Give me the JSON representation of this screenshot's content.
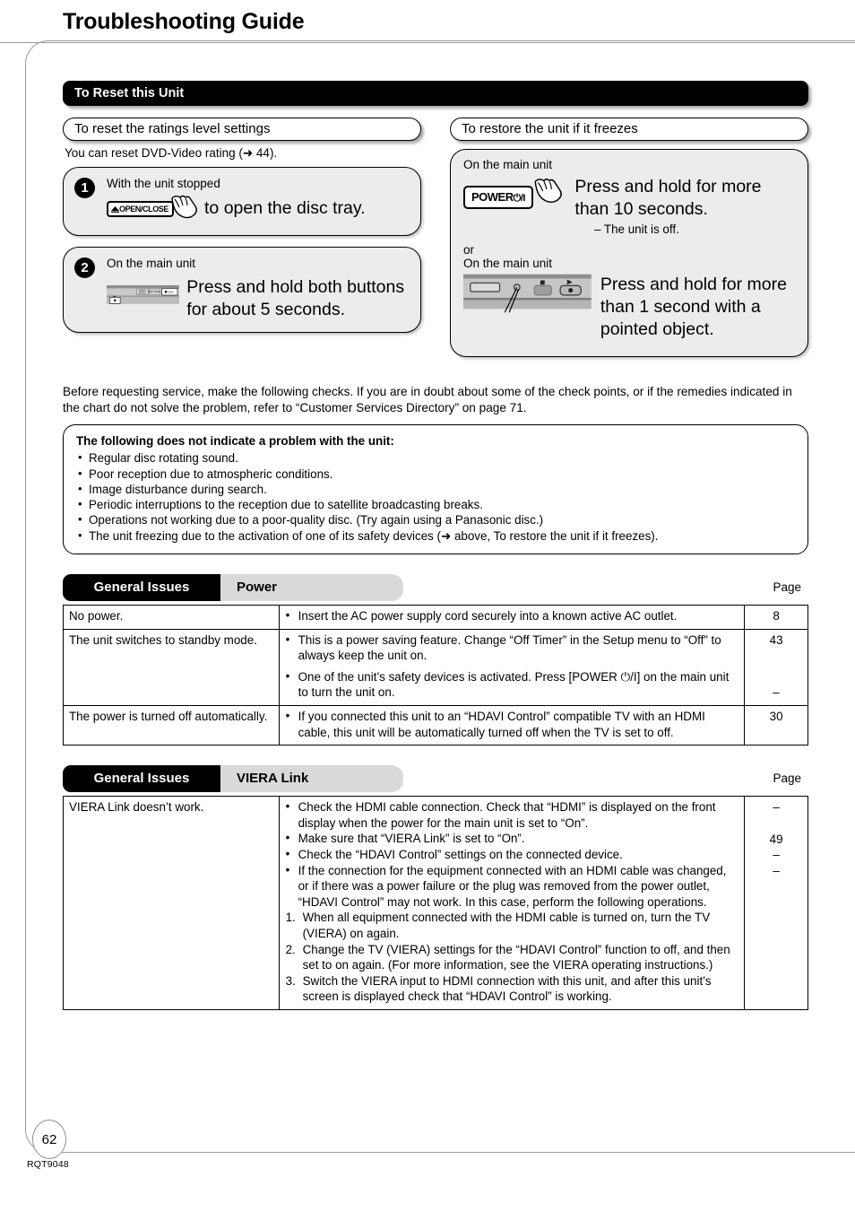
{
  "page": {
    "title": "Troubleshooting Guide",
    "page_number": "62",
    "doc_code": "RQT9048"
  },
  "reset_section": {
    "bar_label": "To Reset this Unit",
    "left": {
      "pill_label": "To reset the ratings level settings",
      "hint": "You can reset DVD-Video rating (➜ 44).",
      "steps": [
        {
          "num": "1",
          "caption": "With the unit stopped",
          "button_label": "OPEN/CLOSE",
          "instruction": "to open the disc tray."
        },
        {
          "num": "2",
          "caption": "On the main unit",
          "panel_buttons": [
            "INPUT SELECT",
            "REC MODE",
            "REC"
          ],
          "instruction": "Press and hold both buttons for about 5 seconds."
        }
      ]
    },
    "right": {
      "pill_label": "To restore the unit if it freezes",
      "caption1": "On the main unit",
      "power_button_label": "POWER",
      "power_symbol": "⏻/I",
      "instruction1": "Press and hold for more than 10 seconds.",
      "sub1": "– The unit is off.",
      "or_label": "or",
      "caption2": "On the main unit",
      "instruction2": "Press and hold for more than 1 second with a pointed object."
    }
  },
  "intro": "Before requesting service, make the following checks. If you are in doubt about some of the check points, or if the remedies indicated in the chart do not solve the problem, refer to “Customer Services Directory” on page 71.",
  "note_box": {
    "title": "The following does not indicate a problem with the unit:",
    "items": [
      "Regular disc rotating sound.",
      "Poor reception due to atmospheric conditions.",
      "Image disturbance during search.",
      "Periodic interruptions to the reception due to satellite broadcasting breaks.",
      "Operations not working due to a poor-quality disc. (Try again using a Panasonic disc.)",
      "The unit freezing due to the activation of one of its safety devices (➜ above, To restore the unit if it freezes)."
    ]
  },
  "tables": [
    {
      "general_label": "General Issues",
      "topic_label": "Power",
      "page_label": "Page",
      "rows": [
        {
          "symptom": "No power.",
          "remedies": [
            {
              "text": "Insert the AC power supply cord securely into a known active AC outlet.",
              "page": "8"
            }
          ]
        },
        {
          "symptom": "The unit switches to standby mode.",
          "remedies": [
            {
              "text": "This is a power saving feature. Change “Off Timer” in the Setup menu to “Off” to always keep the unit on.",
              "page": "43"
            },
            {
              "text": "One of the unit’s safety devices is activated. Press [POWER ⏻/I] on the main unit to turn the unit on.",
              "page": "–"
            }
          ]
        },
        {
          "symptom": "The power is turned off automatically.",
          "remedies": [
            {
              "text": "If you connected this unit to an “HDAVI Control” compatible TV with an HDMI cable, this unit will be automatically turned off when the TV is set to off.",
              "page": "30"
            }
          ]
        }
      ]
    },
    {
      "general_label": "General Issues",
      "topic_label": "VIERA Link",
      "page_label": "Page",
      "rows": [
        {
          "symptom": "VIERA Link doesn’t work.",
          "remedies": [
            {
              "text": "Check the HDMI cable connection. Check that “HDMI” is displayed on the front display when the power for the main unit is set to “On”.",
              "page": "–"
            },
            {
              "text": "Make sure that “VIERA Link” is set to “On”.",
              "page": "49"
            },
            {
              "text": "Check the “HDAVI Control” settings on the connected device.",
              "page": "–"
            },
            {
              "text": "If the connection for the equipment connected with an HDMI cable was changed, or if there was a power failure or the plug was removed from the power outlet, “HDAVI Control” may not work. In this case, perform the following operations.",
              "page": "–"
            }
          ],
          "numbered": [
            {
              "n": "1.",
              "text": "When all equipment connected with the HDMI cable is turned on, turn the TV (VIERA) on again."
            },
            {
              "n": "2.",
              "text": "Change the TV (VIERA) settings for the “HDAVI Control” function to off, and then set to on again. (For more information, see the VIERA operating instructions.)"
            },
            {
              "n": "3.",
              "text": "Switch the VIERA input to HDMI connection with this unit, and after this unit’s screen is displayed check that “HDAVI Control” is working."
            }
          ]
        }
      ]
    }
  ]
}
